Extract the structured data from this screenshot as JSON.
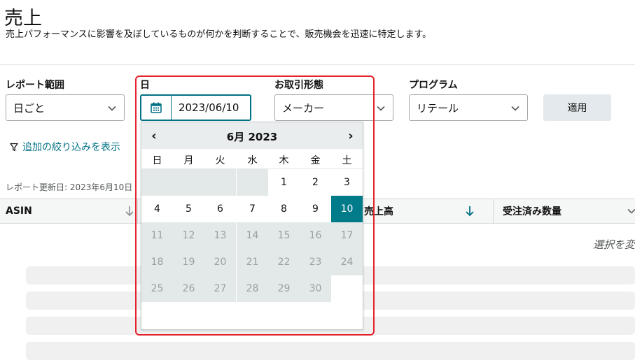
{
  "page": {
    "title": "売上",
    "subtitle": "売上パフォーマンスに影響を及ぼしているものが何かを判断することで、販売機会を迅速に特定します。"
  },
  "filters": {
    "report_range": {
      "label": "レポート範囲",
      "value": "日ごと"
    },
    "date": {
      "label": "日",
      "value": "2023/06/10"
    },
    "distributor": {
      "label": "お取引形態",
      "value": "メーカー"
    },
    "program": {
      "label": "プログラム",
      "value": "リテール"
    },
    "apply_label": "適用",
    "more_filters_label": "追加の絞り込みを表示"
  },
  "report": {
    "updated_text": "レポート更新日: 2023年6月10日",
    "columns": [
      "ASIN",
      "売上高",
      "受注済み数量"
    ],
    "placeholder": "選択を変"
  },
  "calendar": {
    "month_label": "6月 2023",
    "prev_label": "‹",
    "next_label": "›",
    "weekdays": [
      "日",
      "月",
      "火",
      "水",
      "木",
      "金",
      "土"
    ],
    "selected": 10,
    "first_weekday": 4,
    "days_in_month": 30,
    "last_enabled": 10
  },
  "colors": {
    "accent": "#007185",
    "selected_day": "#007b8a",
    "highlight_border": "#e4222b"
  },
  "icons": {
    "calendar": "calendar-icon",
    "filter": "filter-icon",
    "chevron": "chevron-down-icon",
    "sort": "arrow-down-icon"
  }
}
